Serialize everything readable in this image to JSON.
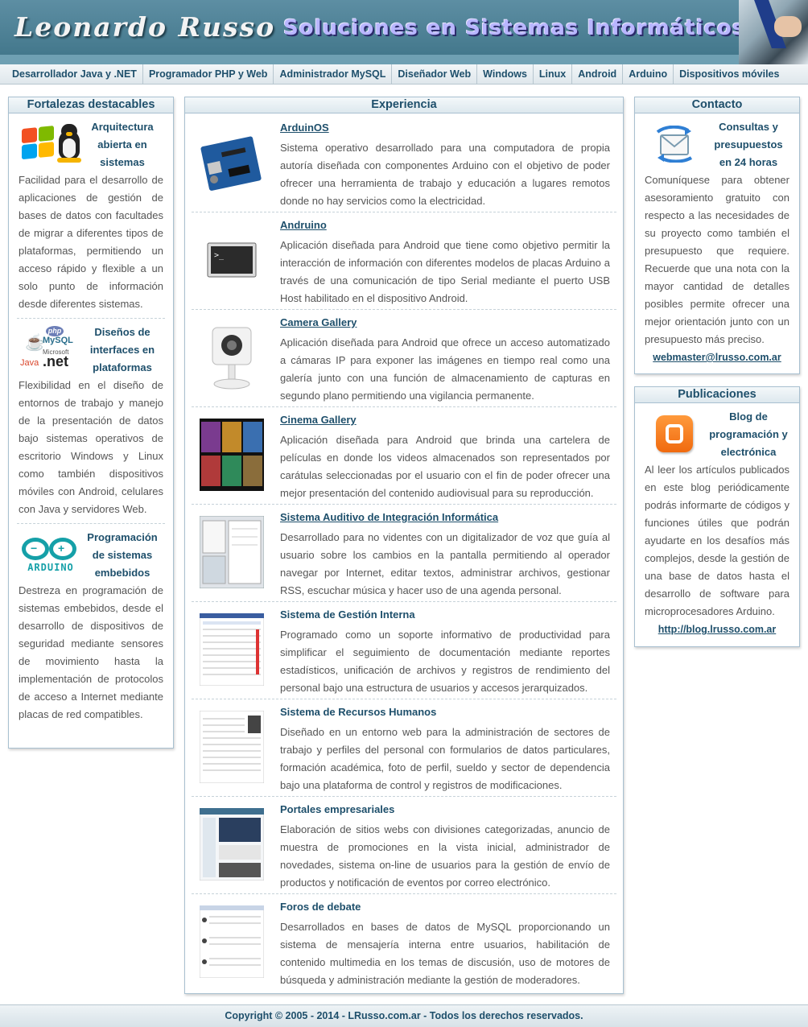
{
  "header": {
    "name": "Leonardo Russo",
    "tagline": "Soluciones en Sistemas Informáticos"
  },
  "nav": {
    "items": [
      "Desarrollador Java y .NET",
      "Programador PHP y Web",
      "Administrador MySQL",
      "Diseñador Web",
      "Windows",
      "Linux",
      "Android",
      "Arduino",
      "Dispositivos móviles"
    ]
  },
  "left": {
    "title": "Fortalezas destacables",
    "items": [
      {
        "title": "Arquitectura abierta en sistemas",
        "icon": "windows-linux-icon",
        "text": "Facilidad para el desarrollo de aplicaciones de gestión de bases de datos con facultades de migrar a diferentes tipos de plataformas, permitiendo un acceso rápido y flexible a un solo punto de información desde diferentes sistemas."
      },
      {
        "title": "Diseños de interfaces en plataformas",
        "icon": "java-php-mysql-net-icon",
        "icon_labels": [
          "php",
          "MySQL",
          "Java",
          "Microsoft",
          ".net"
        ],
        "text": "Flexibilidad en el diseño de entornos de trabajo y manejo de la presentación de datos bajo sistemas operativos de escritorio Windows y Linux como también dispositivos móviles con Android, celulares con Java y servidores Web."
      },
      {
        "title": "Programación de sistemas embebidos",
        "icon": "arduino-icon",
        "icon_label": "ARDUINO",
        "text": "Destreza en programación de sistemas embebidos, desde el desarrollo de dispositivos de seguridad mediante sensores de movimiento hasta la implementación de protocolos de acceso a Internet mediante placas de red compatibles."
      }
    ]
  },
  "center": {
    "title": "Experiencia",
    "items": [
      {
        "title": "ArduinOS",
        "linked": true,
        "thumb": "arduino-board",
        "text": "Sistema operativo desarrollado para una computadora de propia autoría diseñada con componentes Arduino con el objetivo de poder ofrecer una herramienta de trabajo y educación a lugares remotos donde no hay servicios como la electricidad."
      },
      {
        "title": "Andruino",
        "linked": true,
        "thumb": "terminal",
        "text": "Aplicación diseñada para Android que tiene como objetivo permitir la interacción de información con diferentes modelos de placas Arduino a través de una comunicación de tipo Serial mediante el puerto USB Host habilitado en el dispositivo Android."
      },
      {
        "title": "Camera Gallery",
        "linked": true,
        "thumb": "ip-camera",
        "text": "Aplicación diseñada para Android que ofrece un acceso automatizado a cámaras IP para exponer las imágenes en tiempo real como una galería junto con una función de almacenamiento de capturas en segundo plano permitiendo una vigilancia permanente."
      },
      {
        "title": "Cinema Gallery",
        "linked": true,
        "thumb": "movie-posters",
        "text": "Aplicación diseñada para Android que brinda una cartelera de películas en donde los videos almacenados son representados por carátulas seleccionadas por el usuario con el fin de poder ofrecer una mejor presentación del contenido audiovisual para su reproducción."
      },
      {
        "title": "Sistema Auditivo de Integración Informática",
        "linked": true,
        "thumb": "desktop-app",
        "text": "Desarrollado para no videntes con un digitalizador de voz que guía al usuario sobre los cambios en la pantalla permitiendo al operador navegar por Internet, editar textos, administrar archivos, gestionar RSS, escuchar música y hacer uso de una agenda personal."
      },
      {
        "title": "Sistema de Gestión Interna",
        "linked": false,
        "thumb": "report-table",
        "text": "Programado como un soporte informativo de productividad para simplificar el seguimiento de documentación mediante reportes estadísticos, unificación de archivos y registros de rendimiento del personal bajo una estructura de usuarios y accesos jerarquizados."
      },
      {
        "title": "Sistema de Recursos Humanos",
        "linked": false,
        "thumb": "hr-form",
        "text": "Diseñado en un entorno web para la administración de sectores de trabajo y perfiles del personal con formularios de datos particulares, formación académica, foto de perfil, sueldo y sector de dependencia bajo una plataforma de control y registros de modificaciones."
      },
      {
        "title": "Portales empresariales",
        "linked": false,
        "thumb": "web-portal",
        "text": "Elaboración de sitios webs con divisiones categorizadas, anuncio de muestra de promociones en la vista inicial, administrador de novedades, sistema on-line de usuarios para la gestión de envío de productos y notificación de eventos por correo electrónico."
      },
      {
        "title": "Foros de debate",
        "linked": false,
        "thumb": "forum",
        "text": "Desarrollados en bases de datos de MySQL proporcionando un sistema de mensajería interna entre usuarios, habilitación de contenido multimedia en los temas de discusión, uso de motores de búsqueda y administración mediante la gestión de moderadores."
      }
    ]
  },
  "contact": {
    "title": "Contacto",
    "head": "Consultas y presupuestos en 24 horas",
    "icon": "envelope-arrows-icon",
    "text": "Comuníquese para obtener asesoramiento gratuito con respecto a las necesidades de su proyecto como también el presupuesto que requiere. Recuerde que una nota con la mayor cantidad de detalles posibles permite ofrecer una mejor orientación junto con un presupuesto más preciso.",
    "link": "webmaster@lrusso.com.ar"
  },
  "publications": {
    "title": "Publicaciones",
    "head": "Blog de programación y electrónica",
    "icon": "blogger-icon",
    "text": "Al leer los artículos publicados en este blog periódicamente podrás informarte de códigos y funciones útiles que podrán ayudarte en los desafíos más complejos, desde la gestión de una base de datos hasta el desarrollo de software para microprocesadores Arduino.",
    "link": "http://blog.lrusso.com.ar"
  },
  "footer": {
    "text": "Copyright © 2005 - 2014 - LRusso.com.ar - Todos los derechos reservados."
  },
  "colors": {
    "accent": "#1e4f6b",
    "header": "#4a7f93",
    "panel_border": "#a8c0d0",
    "body_text": "#555555"
  }
}
